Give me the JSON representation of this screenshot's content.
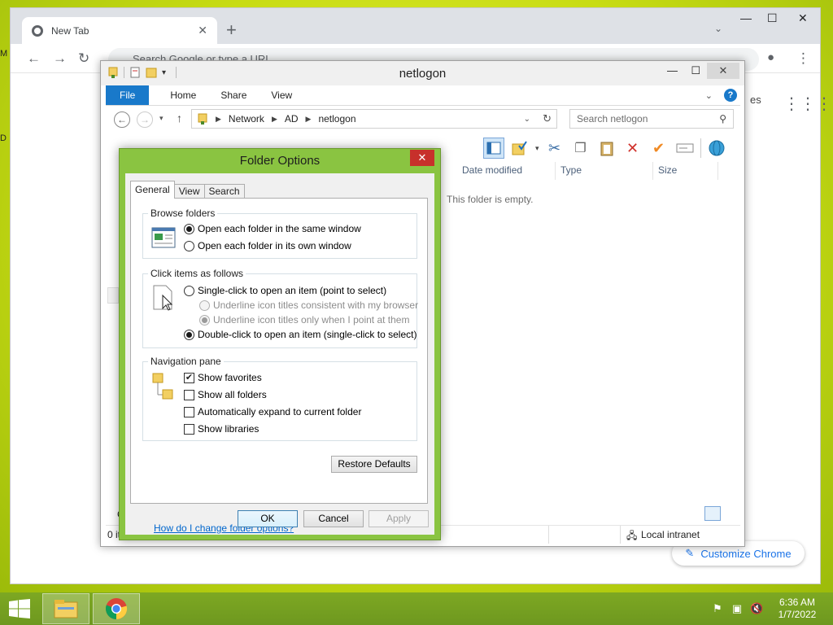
{
  "desktop": {
    "left_peek_top": "M",
    "left_peek_mid": "D"
  },
  "chrome": {
    "tab_title": "New Tab",
    "new_tab_symbol": "+",
    "omnibox_placeholder": "Search Google or type a URL",
    "right_peek_text": "es",
    "customize_label": "Customize Chrome"
  },
  "explorer": {
    "title": "netlogon",
    "ribbon_tabs": [
      "File",
      "Home",
      "Share",
      "View"
    ],
    "breadcrumb": [
      "Network",
      "AD",
      "netlogon"
    ],
    "search_placeholder": "Search netlogon",
    "columns": [
      "Date modified",
      "Type",
      "Size"
    ],
    "empty_message": "This folder is empty.",
    "status_items": "0 it",
    "status_zone": "Local intranet",
    "left_peek_c": "C"
  },
  "dialog": {
    "title": "Folder Options",
    "tabs": [
      "General",
      "View",
      "Search"
    ],
    "browse_folders": {
      "label": "Browse folders",
      "options": [
        "Open each folder in the same window",
        "Open each folder in its own window"
      ],
      "selected_index": 0
    },
    "click_items": {
      "label": "Click items as follows",
      "single_click": "Single-click to open an item (point to select)",
      "underline_consistent": "Underline icon titles consistent with my browser",
      "underline_point": "Underline icon titles only when I point at them",
      "double_click": "Double-click to open an item (single-click to select)",
      "selected": "double_click"
    },
    "navigation_pane": {
      "label": "Navigation pane",
      "options": [
        {
          "label": "Show favorites",
          "checked": true
        },
        {
          "label": "Show all folders",
          "checked": false
        },
        {
          "label": "Automatically expand to current folder",
          "checked": false
        },
        {
          "label": "Show libraries",
          "checked": false
        }
      ]
    },
    "restore_defaults": "Restore Defaults",
    "help_link": "How do I change folder options?",
    "ok": "OK",
    "cancel": "Cancel",
    "apply": "Apply"
  },
  "taskbar": {
    "time": "6:36 AM",
    "date": "1/7/2022"
  },
  "colors": {
    "dialog_frame": "#8ac441",
    "ribbon_file": "#1979ca",
    "close_red": "#c7302b",
    "taskbar": "#7da822",
    "link": "#0066cc"
  }
}
